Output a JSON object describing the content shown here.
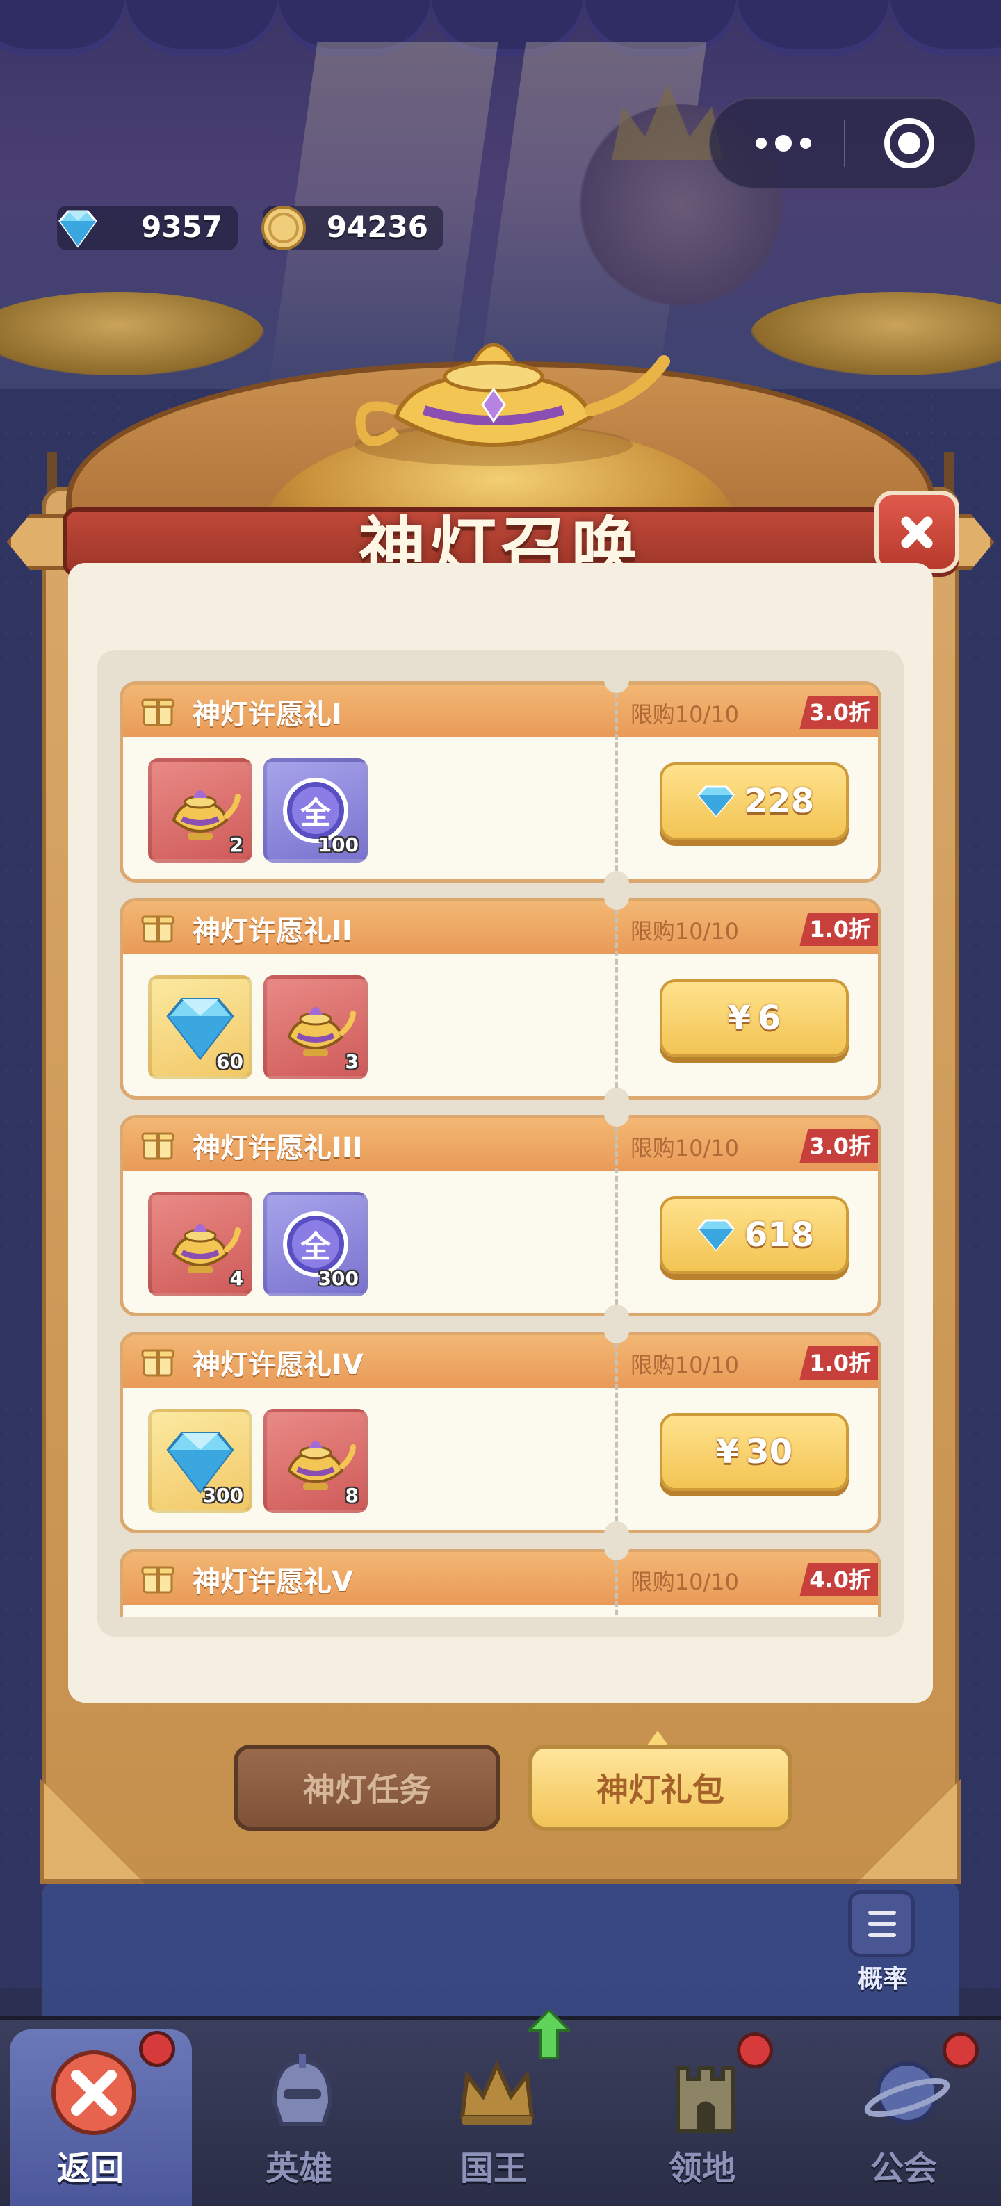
{
  "hud": {
    "diamonds": "9357",
    "coins": "94236",
    "more_icon": "more-dots-icon",
    "target_icon": "target-icon"
  },
  "panel": {
    "title": "神灯召唤",
    "close_icon": "close-icon"
  },
  "gifts": [
    {
      "name": "神灯许愿礼I",
      "limit": "限购10/10",
      "discount": "3.0折",
      "items": [
        {
          "icon": "magic-lamp-icon",
          "count": "2"
        },
        {
          "icon": "all-token-icon",
          "count": "100",
          "glyph": "全"
        }
      ],
      "price_type": "diamond",
      "price": "228"
    },
    {
      "name": "神灯许愿礼II",
      "limit": "限购10/10",
      "discount": "1.0折",
      "items": [
        {
          "icon": "diamond-icon",
          "count": "60"
        },
        {
          "icon": "magic-lamp-icon",
          "count": "3"
        }
      ],
      "price_type": "cash",
      "price": "6",
      "currency": "¥"
    },
    {
      "name": "神灯许愿礼III",
      "limit": "限购10/10",
      "discount": "3.0折",
      "items": [
        {
          "icon": "magic-lamp-icon",
          "count": "4"
        },
        {
          "icon": "all-token-icon",
          "count": "300",
          "glyph": "全"
        }
      ],
      "price_type": "diamond",
      "price": "618"
    },
    {
      "name": "神灯许愿礼IV",
      "limit": "限购10/10",
      "discount": "1.0折",
      "items": [
        {
          "icon": "diamond-icon",
          "count": "300"
        },
        {
          "icon": "magic-lamp-icon",
          "count": "8"
        }
      ],
      "price_type": "cash",
      "price": "30",
      "currency": "¥"
    },
    {
      "name": "神灯许愿礼V",
      "limit": "限购10/10",
      "discount": "4.0折"
    }
  ],
  "tabs": {
    "task": "神灯任务",
    "gift": "神灯礼包",
    "active": "gift"
  },
  "probability": {
    "label": "概率",
    "icon": "list-document-icon"
  },
  "nav": [
    {
      "label": "返回",
      "icon": "close-icon",
      "active": true,
      "badge": true
    },
    {
      "label": "英雄",
      "icon": "helmet-icon",
      "active": false,
      "badge": false
    },
    {
      "label": "国王",
      "icon": "crown-icon",
      "active": false,
      "badge": false,
      "upgrade_arrow": true
    },
    {
      "label": "领地",
      "icon": "castle-icon",
      "active": false,
      "badge": true
    },
    {
      "label": "公会",
      "icon": "planet-icon",
      "active": false,
      "badge": true
    }
  ],
  "colors": {
    "accent_gold": "#f2c453",
    "discount_red": "#c8403b",
    "header_orange": "#e99a58"
  }
}
